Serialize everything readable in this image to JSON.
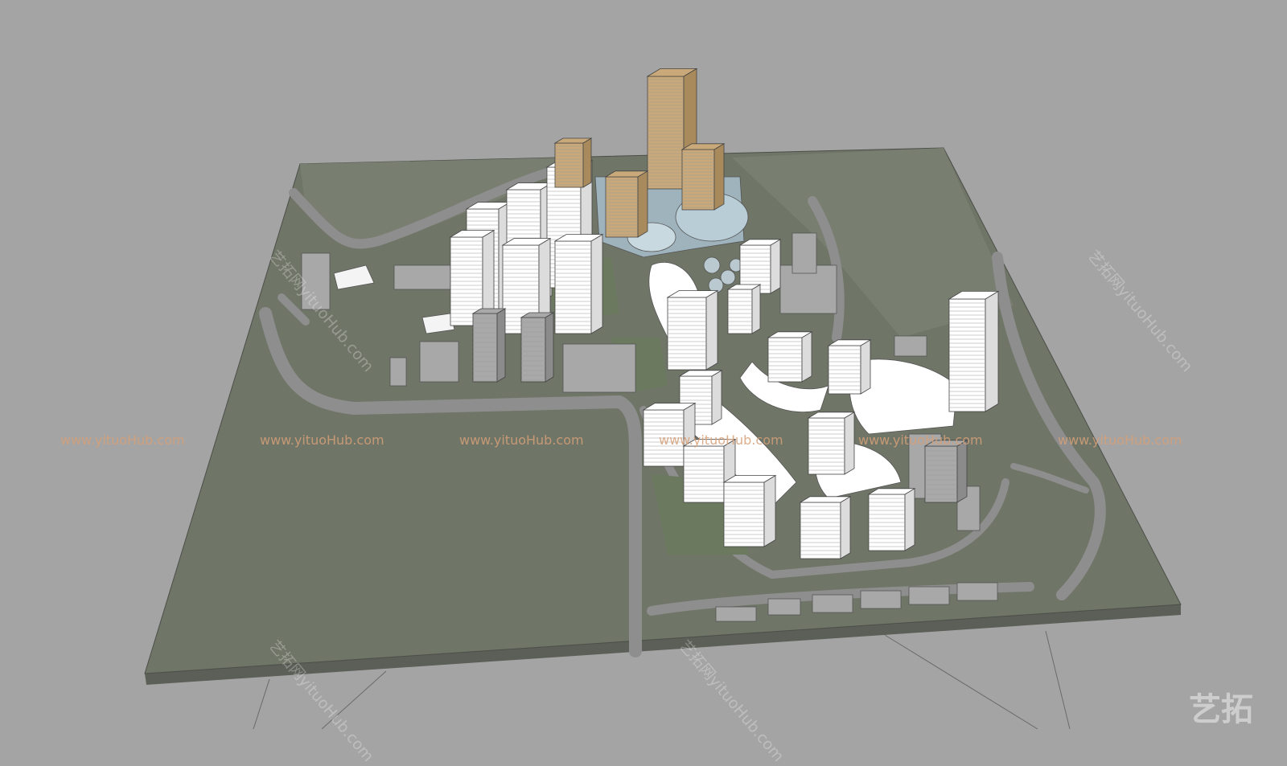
{
  "scene": {
    "colors": {
      "background": "#a4a4a4",
      "terrain": "#6f7567",
      "terrain_edge": "#5b5f57",
      "road": "#8e8e8e",
      "plaza": "#b5b5b5",
      "tower_white": "#ffffff",
      "tower_gold": "#c9a979",
      "glass": "#8fb8c8",
      "lowrise_grey": "#9d9d9d"
    }
  },
  "watermark": {
    "horizontal": [
      "www.yituoHub.com",
      "www.yituoHub.com",
      "www.yituoHub.com",
      "www.yituoHub.com",
      "www.yituoHub.com",
      "www.yituoHub.com"
    ],
    "diagonal": [
      "艺拓网yituoHub.com",
      "艺拓网yituoHub.com",
      "艺拓网yituoHub.com",
      "艺拓网yituoHub.com"
    ],
    "logo_text": "艺拓"
  }
}
